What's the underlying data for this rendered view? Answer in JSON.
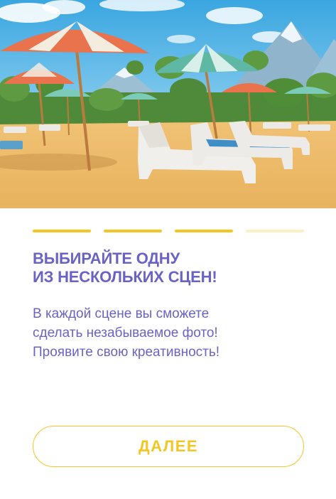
{
  "hero": {
    "icon": "beach-scene-illustration"
  },
  "progress": {
    "total_steps": 4,
    "current_step": 3,
    "active_color": "#f3c623",
    "inactive_color": "#fdf0c4"
  },
  "title": {
    "line1": "ВЫБИРАЙТЕ ОДНУ",
    "line2": "ИЗ НЕСКОЛЬКИХ СЦЕН!"
  },
  "description": {
    "line1": "В каждой сцене вы сможете",
    "line2": "сделать незабываемое фото!",
    "line3": "Проявите свою креативность!"
  },
  "next_button": {
    "label": "ДАЛЕЕ"
  },
  "colors": {
    "text": "#6a63c4",
    "accent": "#f3c623"
  }
}
